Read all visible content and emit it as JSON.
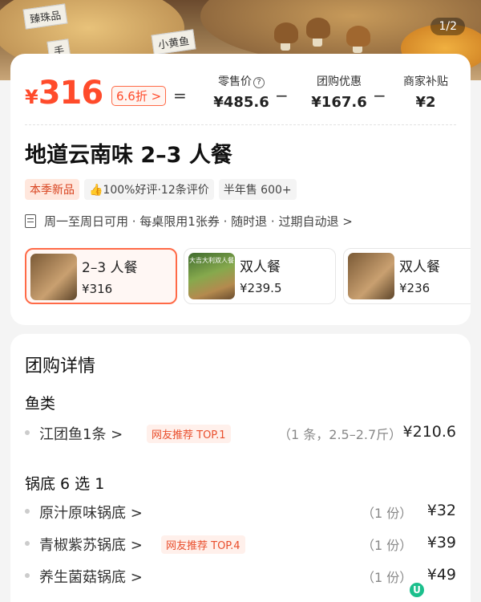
{
  "hero": {
    "page_indicator": "1/2",
    "signs": [
      "臻珠品",
      "小黄鱼",
      "手"
    ]
  },
  "price": {
    "currency": "¥",
    "amount": "316",
    "discount": "6.6折 >",
    "equals": "=",
    "minus": "−",
    "retail_label": "零售价",
    "retail_value": "¥485.6",
    "group_label": "团购优惠",
    "group_value": "¥167.6",
    "merchant_label": "商家补贴",
    "merchant_value": "¥2"
  },
  "deal": {
    "title": "地道云南味 2–3 人餐",
    "badge_new": "本季新品",
    "badge_rating": "👍100%好评·12条评价",
    "badge_sold": "半年售 600+",
    "rules": "周一至周日可用 · 每桌限用1张券 · 随时退 · 过期自动退 >"
  },
  "packages": [
    {
      "name": "2–3 人餐",
      "price": "¥316",
      "selected": true
    },
    {
      "name": "双人餐",
      "price": "¥239.5",
      "selected": false,
      "thumb_text": "大吉大利双人餐"
    },
    {
      "name": "双人餐",
      "price": "¥236",
      "selected": false
    }
  ],
  "detail": {
    "heading": "团购详情",
    "section_fish": "鱼类",
    "fish_item": {
      "name": "江团鱼1条 >",
      "tag": "网友推荐 TOP.1",
      "qty": "（1 条，2.5–2.7斤）",
      "price": "¥210.6"
    },
    "section_pot": "锅底 6 选 1",
    "pot_items": [
      {
        "name": "原汁原味锅底 >",
        "tag": "",
        "qty": "（1 份）",
        "price": "¥32"
      },
      {
        "name": "青椒紫苏锅底 >",
        "tag": "网友推荐 TOP.4",
        "qty": "（1 份）",
        "price": "¥39"
      },
      {
        "name": "养生菌菇锅底 >",
        "tag": "",
        "qty": "（1 份）",
        "price": "¥49"
      }
    ]
  },
  "colors": {
    "accent": "#ff4b2b",
    "badge_new_bg": "#ffe7dd"
  }
}
